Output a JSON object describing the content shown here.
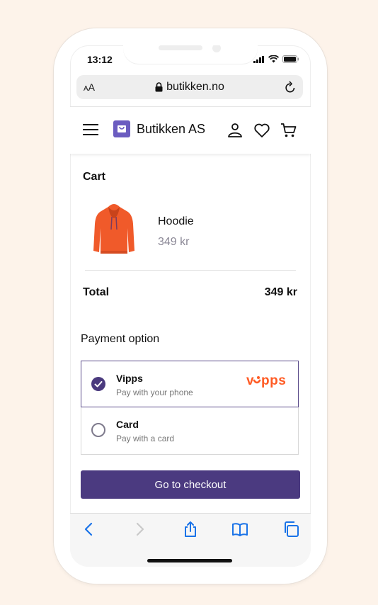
{
  "status": {
    "time": "13:12"
  },
  "browser": {
    "text_size_label": "AA",
    "url": "butikken.no"
  },
  "header": {
    "brand": "Butikken AS"
  },
  "cart": {
    "title": "Cart",
    "items": [
      {
        "name": "Hoodie",
        "price": "349 kr"
      }
    ],
    "total_label": "Total",
    "total_value": "349 kr"
  },
  "payment": {
    "title": "Payment option",
    "options": [
      {
        "name": "Vipps",
        "description": "Pay with your phone",
        "selected": true,
        "logo": "vipps"
      },
      {
        "name": "Card",
        "description": "Pay with a card",
        "selected": false
      }
    ]
  },
  "checkout_label": "Go to checkout",
  "colors": {
    "accent": "#4b3a80",
    "vipps": "#ff5b24",
    "product": "#f05a2a"
  }
}
